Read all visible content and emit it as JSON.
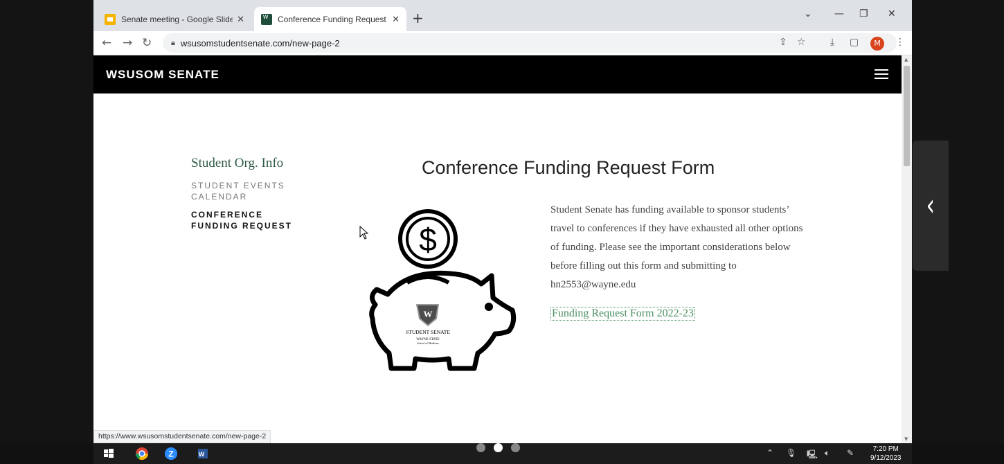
{
  "browser": {
    "tabs": [
      {
        "title": "Senate meeting - Google Slides",
        "icon": "slides-icon"
      },
      {
        "title": "Conference Funding Request — ​",
        "icon": "site-icon"
      }
    ],
    "new_tab": "+",
    "url": "wsusomstudentsenate.com/new-page-2",
    "avatar_letter": "M",
    "status_url": "https://www.wsusomstudentsenate.com/new-page-2"
  },
  "site": {
    "brand": "WSUSOM SENATE",
    "sidenav": {
      "title": "Student Org. Info",
      "items": [
        "STUDENT EVENTS CALENDAR",
        "CONFERENCE FUNDING REQUEST"
      ]
    },
    "heading": "Conference Funding Request Form",
    "body": "Student Senate has funding available to sponsor students’ travel to conferences if they have exhausted all other options of funding. Please see the important considerations below before filling out this form and submitting to hn2553@wayne.edu",
    "link": "Funding Request Form 2022-23",
    "logo": {
      "line1": "STUDENT SENATE",
      "line2": "WAYNE STATE",
      "line3": "School of Medicine"
    }
  },
  "taskbar": {
    "time": "7:20 PM",
    "date": "9/12/2023"
  },
  "colors": {
    "accent": "#4a8f61",
    "heading_green": "#2f5a46"
  }
}
